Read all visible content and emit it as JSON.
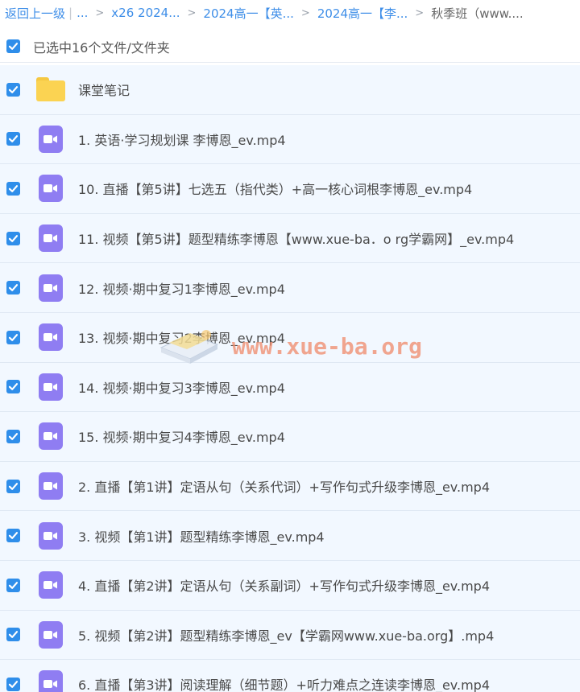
{
  "breadcrumb": {
    "back_label": "返回上一级",
    "ellipsis": "...",
    "crumbs": [
      "x26 2024...",
      "2024高一【英...",
      "2024高一【李..."
    ],
    "current": "秋季班（www...."
  },
  "selection": {
    "summary": "已选中16个文件/文件夹",
    "all_checked": true
  },
  "files": [
    {
      "name": "课堂笔记",
      "type": "folder",
      "checked": true
    },
    {
      "name": "1. 英语·学习规划课 李博恩_ev.mp4",
      "type": "video",
      "checked": true
    },
    {
      "name": "10. 直播【第5讲】七选五（指代类）+高一核心词根李博恩_ev.mp4",
      "type": "video",
      "checked": true
    },
    {
      "name": "11. 视频【第5讲】题型精练李博恩【www.xue-ba．o rg学霸网】_ev.mp4",
      "type": "video",
      "checked": true
    },
    {
      "name": "12. 视频·期中复习1李博恩_ev.mp4",
      "type": "video",
      "checked": true
    },
    {
      "name": "13. 视频·期中复习2李博恩_ev.mp4",
      "type": "video",
      "checked": true
    },
    {
      "name": "14. 视频·期中复习3李博恩_ev.mp4",
      "type": "video",
      "checked": true
    },
    {
      "name": "15. 视频·期中复习4李博恩_ev.mp4",
      "type": "video",
      "checked": true
    },
    {
      "name": "2. 直播【第1讲】定语从句（关系代词）+写作句式升级李博恩_ev.mp4",
      "type": "video",
      "checked": true
    },
    {
      "name": "3. 视频【第1讲】题型精练李博恩_ev.mp4",
      "type": "video",
      "checked": true
    },
    {
      "name": "4. 直播【第2讲】定语从句（关系副词）+写作句式升级李博恩_ev.mp4",
      "type": "video",
      "checked": true
    },
    {
      "name": "5. 视频【第2讲】题型精练李博恩_ev【学霸网www.xue-ba.org】.mp4",
      "type": "video",
      "checked": true
    },
    {
      "name": "6. 直播【第3讲】阅读理解（细节题）+听力难点之连读李博恩_ev.mp4",
      "type": "video",
      "checked": true
    }
  ],
  "watermark": {
    "text": "www.xue-ba.org"
  },
  "colors": {
    "link": "#3e8ee8",
    "checkbox": "#2f8eea",
    "video_icon": "#8f7df2",
    "folder_icon": "#fbd352",
    "row_selected_bg": "#f2f8ff",
    "watermark": "#f08a6a"
  },
  "icons": {
    "folder": "folder-icon",
    "video": "video-camera-icon",
    "checkbox": "checkmark-icon",
    "separator": "chevron-right-icon"
  }
}
